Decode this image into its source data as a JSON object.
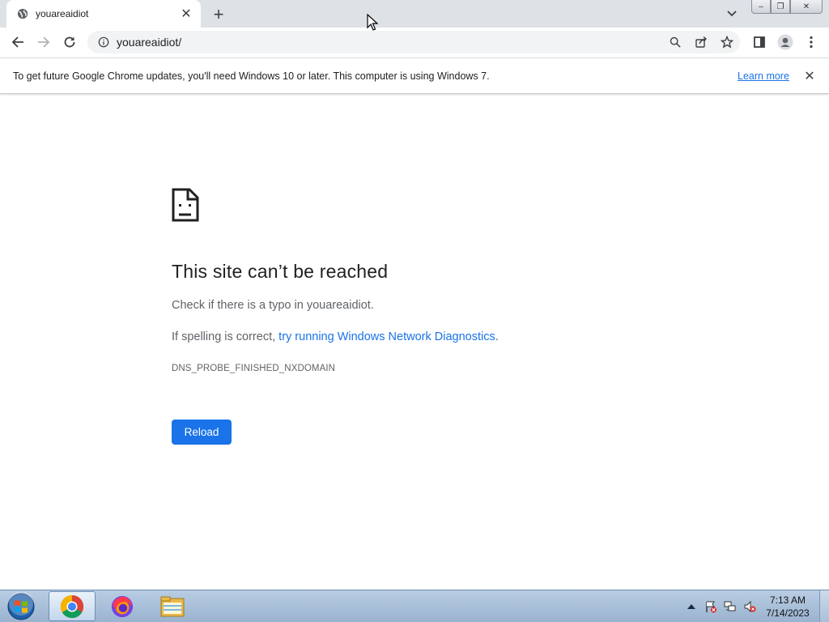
{
  "browser": {
    "tab": {
      "title": "youareaidiot",
      "close_label": "✕"
    },
    "new_tab_label": "+",
    "window_controls": {
      "minimize": "–",
      "maximize": "❐",
      "close": "✕"
    }
  },
  "toolbar": {
    "url": "youareaidiot/"
  },
  "infobar": {
    "message": "To get future Google Chrome updates, you'll need Windows 10 or later. This computer is using Windows 7.",
    "link_label": "Learn more",
    "close_label": "✕"
  },
  "error_page": {
    "title": "This site can’t be reached",
    "line1": "Check if there is a typo in youareaidiot.",
    "line2_prefix": "If spelling is correct, ",
    "line2_link": "try running Windows Network Diagnostics",
    "line2_suffix": ".",
    "error_code": "DNS_PROBE_FINISHED_NXDOMAIN",
    "reload_label": "Reload"
  },
  "taskbar": {
    "items": [
      "chrome",
      "firefox",
      "file-explorer"
    ],
    "clock": {
      "time": "7:13 AM",
      "date": "7/14/2023"
    }
  },
  "colors": {
    "accent": "#1a73e8",
    "text_primary": "#202124",
    "text_secondary": "#5f6368",
    "tabstrip_bg": "#dee1e6"
  }
}
